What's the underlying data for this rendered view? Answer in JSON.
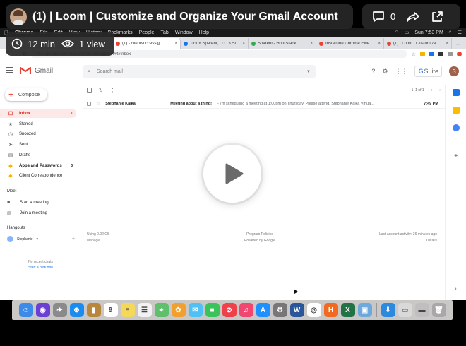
{
  "loom": {
    "title": "(1) | Loom | Customize and Organize Your Gmail Account",
    "duration": "12 min",
    "views": "1 view",
    "comments": "0"
  },
  "menubar": {
    "items": [
      "Chrome",
      "File",
      "Edit",
      "View",
      "History",
      "Bookmarks",
      "People",
      "Tab",
      "Window",
      "Help"
    ],
    "clock": "Sun 7:53 PM"
  },
  "browser": {
    "tabs": [
      {
        "label": "(1) - clientsuccess@...",
        "color": "#ea4335",
        "active": true
      },
      {
        "label": "Tick » Sparent, LLC » Stuff",
        "color": "#1a73e8",
        "active": false
      },
      {
        "label": "Sparent - HourStack",
        "color": "#34a853",
        "active": false
      },
      {
        "label": "Install the Chrome Extens...",
        "color": "#ea4335",
        "active": false
      },
      {
        "label": "(1) | Loom | Customize...",
        "color": "#ea4335",
        "active": false
      }
    ],
    "url": "mail.google.com/mail/u/1/?zx=nmugpm40vt#inbox"
  },
  "gmail": {
    "product": "Gmail",
    "search_placeholder": "Search mail",
    "gsuite": "Suite",
    "avatar_letter": "S",
    "compose": "Compose",
    "nav": [
      {
        "label": "Inbox",
        "icon": "inbox-icon",
        "glyph": "☐",
        "count": "1",
        "active": true,
        "bold": true
      },
      {
        "label": "Starred",
        "icon": "star-icon",
        "glyph": "★",
        "count": "",
        "active": false,
        "bold": false
      },
      {
        "label": "Snoozed",
        "icon": "clock-icon",
        "glyph": "◷",
        "count": "",
        "active": false,
        "bold": false
      },
      {
        "label": "Sent",
        "icon": "send-icon",
        "glyph": "➤",
        "count": "",
        "active": false,
        "bold": false
      },
      {
        "label": "Drafts",
        "icon": "draft-icon",
        "glyph": "▤",
        "count": "",
        "active": false,
        "bold": false
      },
      {
        "label": "Apps and Passwords",
        "icon": "label-icon",
        "glyph": "◆",
        "count": "3",
        "active": false,
        "bold": true
      },
      {
        "label": "Client Correspondence",
        "icon": "label-icon",
        "glyph": "◆",
        "count": "",
        "active": false,
        "bold": false
      }
    ],
    "meet": {
      "heading": "Meet",
      "start": "Start a meeting",
      "join": "Join a meeting"
    },
    "hangouts": {
      "heading": "Hangouts",
      "user": "Stephanie",
      "no_chats": "No recent chats",
      "new_chat": "Start a new one"
    },
    "pager": "1–1 of 1",
    "messages": [
      {
        "sender": "Stephanie Kalka",
        "subject": "Meeting about a thing!",
        "snippet": " - I'm scheduling a meeting at 1:00pm on Thursday. Please attend. Stephanie Kalka Virtua...",
        "time": "7:49 PM"
      }
    ],
    "footer": {
      "storage": "Using 0.02 GB",
      "manage": "Manage",
      "policies": "Program Policies",
      "powered": "Powered by Google",
      "activity": "Last account activity: 36 minutes ago",
      "details": "Details"
    }
  },
  "dock": {
    "apps": [
      {
        "name": "finder",
        "color": "#3d8be8",
        "glyph": "☺"
      },
      {
        "name": "siri",
        "color": "#6a3fd1",
        "glyph": "◉"
      },
      {
        "name": "launchpad",
        "color": "#8a8a8a",
        "glyph": "✈"
      },
      {
        "name": "safari",
        "color": "#1a8cf0",
        "glyph": "⊕"
      },
      {
        "name": "notefile",
        "color": "#b8873c",
        "glyph": "▮"
      },
      {
        "name": "calendar",
        "color": "#ffffff",
        "glyph": "9"
      },
      {
        "name": "notes",
        "color": "#f5d75a",
        "glyph": "≡"
      },
      {
        "name": "reminders",
        "color": "#f2f2f2",
        "glyph": "☰"
      },
      {
        "name": "maps",
        "color": "#5fbf6c",
        "glyph": "⌖"
      },
      {
        "name": "photos",
        "color": "#f0a030",
        "glyph": "✿"
      },
      {
        "name": "messages",
        "color": "#4fc1f5",
        "glyph": "✉"
      },
      {
        "name": "facetime",
        "color": "#3ac35a",
        "glyph": "■"
      },
      {
        "name": "news",
        "color": "#f0404a",
        "glyph": "⊘"
      },
      {
        "name": "music",
        "color": "#f04670",
        "glyph": "♫"
      },
      {
        "name": "app-store",
        "color": "#1e90ff",
        "glyph": "A"
      },
      {
        "name": "system-preferences",
        "color": "#777777",
        "glyph": "⚙"
      },
      {
        "name": "word",
        "color": "#2b579a",
        "glyph": "W"
      },
      {
        "name": "chrome",
        "color": "#ffffff",
        "glyph": "◎"
      },
      {
        "name": "hourstack",
        "color": "#f26a21",
        "glyph": "H"
      },
      {
        "name": "excel",
        "color": "#217346",
        "glyph": "X"
      },
      {
        "name": "preview",
        "color": "#6fa8dc",
        "glyph": "▣"
      },
      {
        "name": "downloads",
        "color": "#2b8ae0",
        "glyph": "⇩"
      },
      {
        "name": "documents",
        "color": "#d9d9d9",
        "glyph": "▭"
      },
      {
        "name": "desktop",
        "color": "#bfbfbf",
        "glyph": "▬"
      },
      {
        "name": "trash",
        "color": "#a8a8a8",
        "glyph": "🗑"
      }
    ]
  }
}
